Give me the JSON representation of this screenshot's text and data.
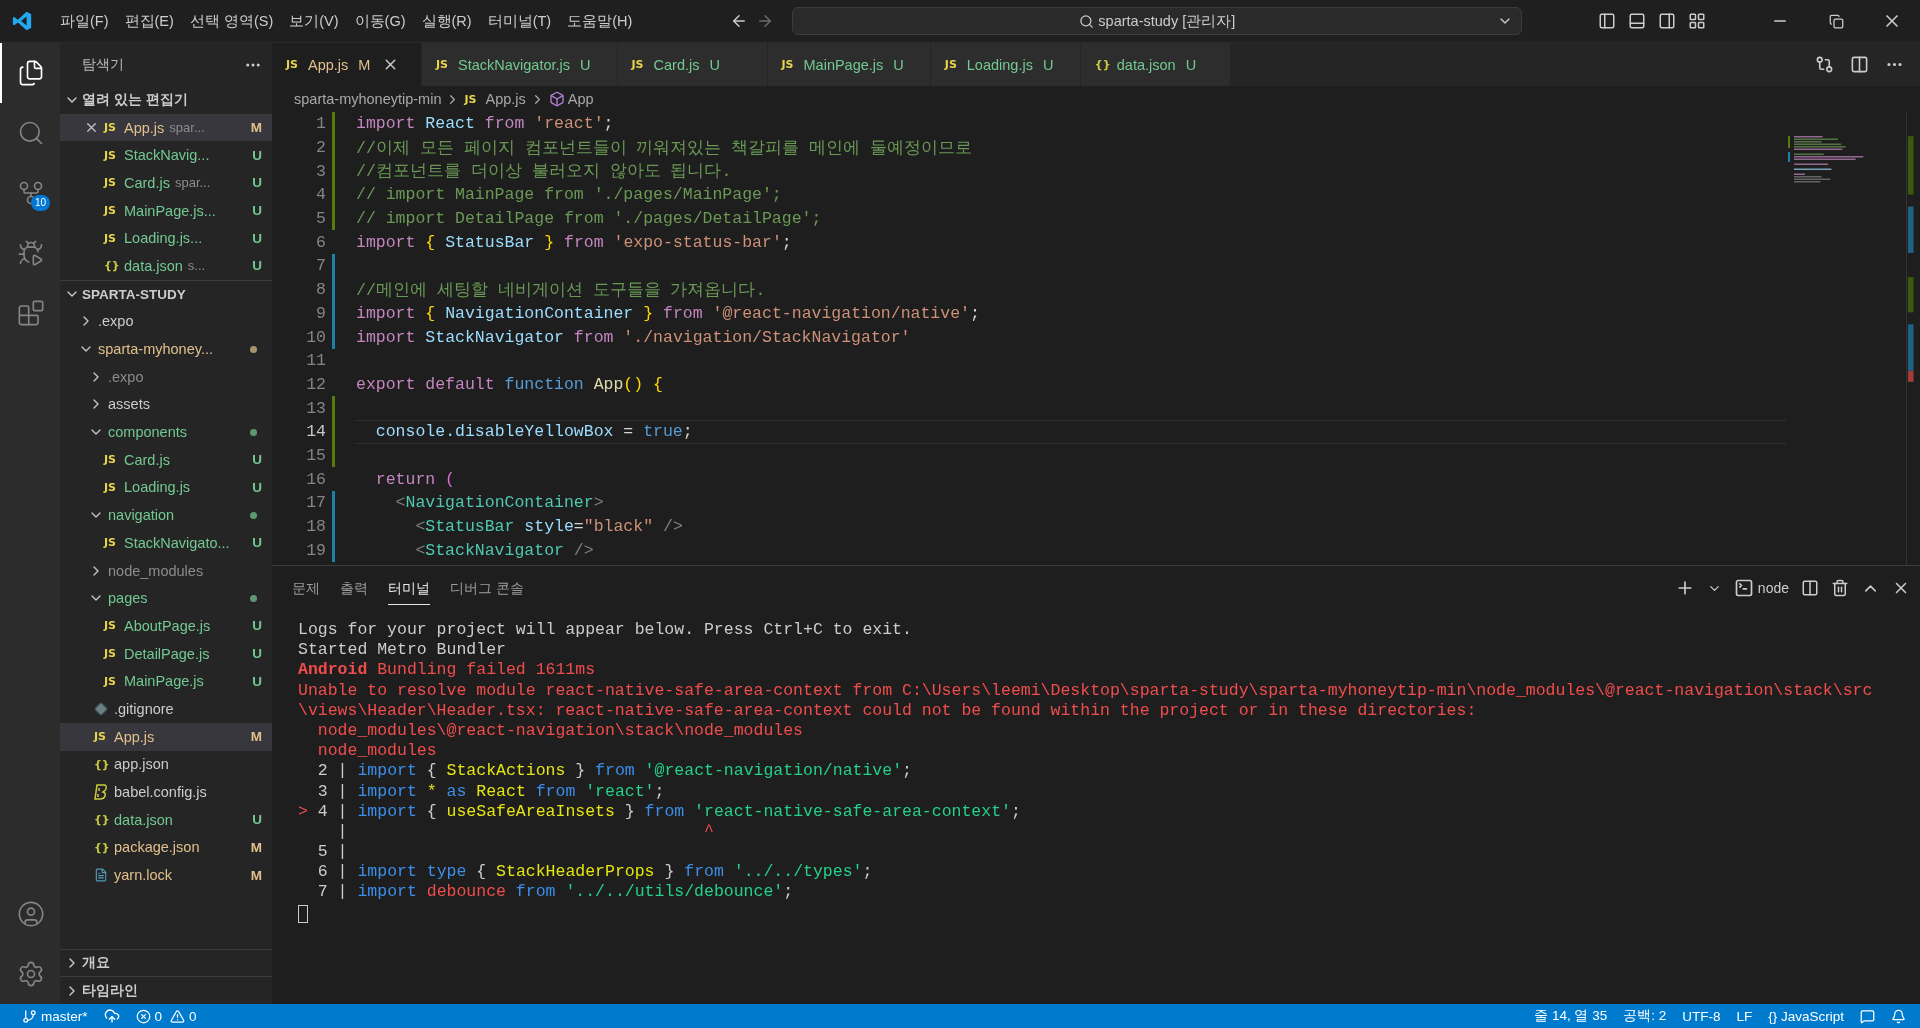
{
  "title_bar": {
    "menu": [
      "파일(F)",
      "편집(E)",
      "선택 영역(S)",
      "보기(V)",
      "이동(G)",
      "실행(R)",
      "터미널(T)",
      "도움말(H)"
    ],
    "search": "sparta-study [관리자]"
  },
  "activity_bar": {
    "items": [
      {
        "kind": "explorer",
        "selected": true
      },
      {
        "kind": "search",
        "selected": false
      },
      {
        "kind": "scm",
        "selected": false,
        "badge": "10"
      },
      {
        "kind": "debug",
        "selected": false
      },
      {
        "kind": "extensions",
        "selected": false
      }
    ],
    "bottom": [
      {
        "kind": "account"
      },
      {
        "kind": "settings"
      }
    ]
  },
  "sidebar": {
    "title": "탐색기",
    "open_editors": {
      "label": "열려 있는 편집기",
      "expanded": true,
      "items": [
        {
          "name": "App.js",
          "description": "spar...",
          "kind": "js",
          "glyph": "JS",
          "status": "M",
          "color": "#e2c08d",
          "selected": true
        },
        {
          "name": "StackNavig...",
          "kind": "js",
          "glyph": "JS",
          "status": "U",
          "color": "#73c991",
          "selected": false
        },
        {
          "name": "Card.js",
          "description": "spar...",
          "kind": "js",
          "glyph": "JS",
          "status": "U",
          "color": "#73c991",
          "selected": false
        },
        {
          "name": "MainPage.js...",
          "kind": "js",
          "glyph": "JS",
          "status": "U",
          "color": "#73c991",
          "selected": false
        },
        {
          "name": "Loading.js...",
          "kind": "js",
          "glyph": "JS",
          "status": "U",
          "color": "#73c991",
          "selected": false
        },
        {
          "name": "data.json",
          "description": "s...",
          "kind": "json",
          "glyph": "{}",
          "status": "U",
          "color": "#73c991",
          "selected": false
        }
      ]
    },
    "workspace": {
      "label": "SPARTA-STUDY",
      "expanded": true,
      "children": [
        {
          "kind": "folder",
          "name": ".expo",
          "expanded": false,
          "color": "#cccccc",
          "dot": false,
          "selected": false
        },
        {
          "kind": "folder",
          "name": "sparta-myhoney...",
          "expanded": true,
          "color": "#e2c08d",
          "dot": true,
          "selected": false,
          "children": [
            {
              "kind": "folder",
              "name": ".expo",
              "expanded": false,
              "color": "#8c8c8c",
              "dot": false,
              "selected": false
            },
            {
              "kind": "folder",
              "name": "assets",
              "expanded": false,
              "color": "#cccccc",
              "dot": false,
              "selected": false
            },
            {
              "kind": "folder",
              "name": "components",
              "expanded": true,
              "color": "#73c991",
              "dot": true,
              "selected": false,
              "children": [
                {
                  "kind": "js",
                  "name": "Card.js",
                  "glyph": "JS",
                  "status": "U",
                  "color": "#73c991",
                  "selected": false
                },
                {
                  "kind": "js",
                  "name": "Loading.js",
                  "glyph": "JS",
                  "status": "U",
                  "color": "#73c991",
                  "selected": false
                }
              ]
            },
            {
              "kind": "folder",
              "name": "navigation",
              "expanded": true,
              "color": "#73c991",
              "dot": true,
              "selected": false,
              "children": [
                {
                  "kind": "js",
                  "name": "StackNavigato...",
                  "glyph": "JS",
                  "status": "U",
                  "color": "#73c991",
                  "selected": false
                }
              ]
            },
            {
              "kind": "folder",
              "name": "node_modules",
              "expanded": false,
              "color": "#8c8c8c",
              "dot": false,
              "selected": false
            },
            {
              "kind": "folder",
              "name": "pages",
              "expanded": true,
              "color": "#73c991",
              "dot": true,
              "selected": false,
              "children": [
                {
                  "kind": "js",
                  "name": "AboutPage.js",
                  "glyph": "JS",
                  "status": "U",
                  "color": "#73c991",
                  "selected": false
                },
                {
                  "kind": "js",
                  "name": "DetailPage.js",
                  "glyph": "JS",
                  "status": "U",
                  "color": "#73c991",
                  "selected": false
                },
                {
                  "kind": "js",
                  "name": "MainPage.js",
                  "glyph": "JS",
                  "status": "U",
                  "color": "#73c991",
                  "selected": false
                }
              ]
            },
            {
              "kind": "git",
              "name": ".gitignore",
              "color": "#cccccc",
              "selected": false
            },
            {
              "kind": "js",
              "name": "App.js",
              "glyph": "JS",
              "status": "M",
              "color": "#e2c08d",
              "selected": true
            },
            {
              "kind": "json",
              "name": "app.json",
              "glyph": "{}",
              "color": "#cccccc",
              "selected": false
            },
            {
              "kind": "babel",
              "name": "babel.config.js",
              "color": "#cccccc",
              "selected": false
            },
            {
              "kind": "json",
              "name": "data.json",
              "glyph": "{}",
              "status": "U",
              "color": "#73c991",
              "selected": false
            },
            {
              "kind": "json",
              "name": "package.json",
              "glyph": "{}",
              "status": "M",
              "color": "#e2c08d",
              "selected": false
            },
            {
              "kind": "yarn",
              "name": "yarn.lock",
              "status": "M",
              "color": "#e2c08d",
              "selected": false
            }
          ]
        }
      ]
    },
    "sections": [
      {
        "label": "개요",
        "expanded": false
      },
      {
        "label": "타임라인",
        "expanded": false
      }
    ]
  },
  "tabs": [
    {
      "label": "App.js",
      "kind": "js",
      "glyph": "JS",
      "status": "M",
      "color": "#e2c08d",
      "selected": true
    },
    {
      "label": "StackNavigator.js",
      "kind": "js",
      "glyph": "JS",
      "status": "U",
      "color": "#73c991",
      "selected": false
    },
    {
      "label": "Card.js",
      "kind": "js",
      "glyph": "JS",
      "status": "U",
      "color": "#73c991",
      "selected": false
    },
    {
      "label": "MainPage.js",
      "kind": "js",
      "glyph": "JS",
      "status": "U",
      "color": "#73c991",
      "selected": false
    },
    {
      "label": "Loading.js",
      "kind": "js",
      "glyph": "JS",
      "status": "U",
      "color": "#73c991",
      "selected": false
    },
    {
      "label": "data.json",
      "kind": "json",
      "glyph": "{}",
      "status": "U",
      "color": "#73c991",
      "selected": false
    }
  ],
  "breadcrumb": [
    {
      "kind": "folder",
      "label": "sparta-myhoneytip-min"
    },
    {
      "kind": "file",
      "glyph": "JS",
      "label": "App.js"
    },
    {
      "kind": "symbol",
      "label": "App"
    }
  ],
  "editor": {
    "lines": [
      {
        "number": "1",
        "kind": "modified",
        "current": false,
        "tokens": [
          {
            "text": "import",
            "kind": "kw"
          },
          {
            "text": " React",
            "kind": "var"
          },
          {
            "text": " from",
            "kind": "kw"
          },
          {
            "text": " 'react'",
            "kind": "str"
          },
          {
            "text": ";",
            "kind": "p"
          }
        ]
      },
      {
        "number": "2",
        "kind": "modified",
        "current": false,
        "tokens": [
          {
            "text": "//이제 모든 페이지 컴포넌트들이 끼워져있는 책갈피를 메인에 둘예정이므로",
            "kind": "com"
          }
        ]
      },
      {
        "number": "3",
        "kind": "modified",
        "current": false,
        "tokens": [
          {
            "text": "//컴포넌트를 더이상 불러오지 않아도 됩니다.",
            "kind": "com"
          }
        ]
      },
      {
        "number": "4",
        "kind": "modified",
        "current": false,
        "tokens": [
          {
            "text": "// import MainPage from './pages/MainPage';",
            "kind": "com"
          }
        ]
      },
      {
        "number": "5",
        "kind": "modified",
        "current": false,
        "tokens": [
          {
            "text": "// import DetailPage from './pages/DetailPage';",
            "kind": "com"
          }
        ]
      },
      {
        "number": "6",
        "kind": "none",
        "current": false,
        "tokens": [
          {
            "text": "import",
            "kind": "kw"
          },
          {
            "text": " {",
            "kind": "brace"
          },
          {
            "text": " StatusBar",
            "kind": "var"
          },
          {
            "text": " }",
            "kind": "brace"
          },
          {
            "text": " from",
            "kind": "kw"
          },
          {
            "text": " 'expo-status-bar'",
            "kind": "str"
          },
          {
            "text": ";",
            "kind": "p"
          }
        ]
      },
      {
        "number": "7",
        "kind": "added",
        "current": false
      },
      {
        "number": "8",
        "kind": "added",
        "current": false,
        "tokens": [
          {
            "text": "//메인에 세팅할 네비게이션 도구들을 가져옵니다.",
            "kind": "com"
          }
        ]
      },
      {
        "number": "9",
        "kind": "added",
        "current": false,
        "tokens": [
          {
            "text": "import",
            "kind": "kw"
          },
          {
            "text": " {",
            "kind": "brace"
          },
          {
            "text": " NavigationContainer",
            "kind": "var"
          },
          {
            "text": " }",
            "kind": "brace"
          },
          {
            "text": " from",
            "kind": "kw"
          },
          {
            "text": " '@react-navigation/native'",
            "kind": "str"
          },
          {
            "text": ";",
            "kind": "p"
          }
        ]
      },
      {
        "number": "10",
        "kind": "added",
        "current": false,
        "tokens": [
          {
            "text": "import",
            "kind": "kw"
          },
          {
            "text": " StackNavigator",
            "kind": "var"
          },
          {
            "text": " from",
            "kind": "kw"
          },
          {
            "text": " './navigation/StackNavigator'",
            "kind": "str"
          }
        ]
      },
      {
        "number": "11",
        "kind": "none",
        "current": false
      },
      {
        "number": "12",
        "kind": "none",
        "current": false,
        "tokens": [
          {
            "text": "export default",
            "kind": "kw"
          },
          {
            "text": " function",
            "kind": "kw2"
          },
          {
            "text": " App",
            "kind": "fn"
          },
          {
            "text": "()",
            "kind": "brace"
          },
          {
            "text": " {",
            "kind": "brace"
          }
        ]
      },
      {
        "number": "13",
        "kind": "modified",
        "current": false
      },
      {
        "number": "14",
        "kind": "modified",
        "current": true,
        "tokens": [
          {
            "text": "  console",
            "kind": "var"
          },
          {
            "text": ".disableYellowBox",
            "kind": "var"
          },
          {
            "text": " =",
            "kind": "p"
          },
          {
            "text": " true",
            "kind": "kw2"
          },
          {
            "text": ";",
            "kind": "p"
          }
        ]
      },
      {
        "number": "15",
        "kind": "modified",
        "current": false
      },
      {
        "number": "16",
        "kind": "none",
        "current": false,
        "tokens": [
          {
            "text": "  return",
            "kind": "kw"
          },
          {
            "text": " (",
            "kind": "brace2"
          }
        ]
      },
      {
        "number": "17",
        "kind": "added",
        "current": false,
        "tokens": [
          {
            "text": "    <",
            "kind": "punct"
          },
          {
            "text": "NavigationContainer",
            "kind": "tag"
          },
          {
            "text": ">",
            "kind": "punct"
          }
        ]
      },
      {
        "number": "18",
        "kind": "added",
        "current": false,
        "tokens": [
          {
            "text": "      <",
            "kind": "punct"
          },
          {
            "text": "StatusBar",
            "kind": "tag"
          },
          {
            "text": " style",
            "kind": "var"
          },
          {
            "text": "=",
            "kind": "p"
          },
          {
            "text": "\"black\"",
            "kind": "str"
          },
          {
            "text": " />",
            "kind": "punct"
          }
        ]
      },
      {
        "number": "19",
        "kind": "added",
        "current": false,
        "tokens": [
          {
            "text": "      <",
            "kind": "punct"
          },
          {
            "text": "StackNavigator",
            "kind": "tag"
          },
          {
            "text": " />",
            "kind": "punct"
          }
        ]
      }
    ]
  },
  "panel": {
    "tabs": [
      {
        "label": "문제",
        "selected": false
      },
      {
        "label": "출력",
        "selected": false
      },
      {
        "label": "터미널",
        "selected": true
      },
      {
        "label": "디버그 콘솔",
        "selected": false
      }
    ],
    "terminal_name": "node",
    "lines": [
      {
        "tokens": [
          {
            "text": "Logs for your project will appear below. Press Ctrl+C to exit.",
            "kind": "t"
          }
        ]
      },
      {
        "tokens": [
          {
            "text": "Started Metro Bundler",
            "kind": "t"
          }
        ]
      },
      {
        "tokens": [
          {
            "text": "Android",
            "kind": "rb"
          },
          {
            "text": " Bundling failed 1611ms",
            "kind": "r"
          }
        ]
      },
      {
        "tokens": [
          {
            "text": "Unable to resolve module react-native-safe-area-context from C:\\Users\\leemi\\Desktop\\sparta-study\\sparta-myhoneytip-min\\node_modules\\@react-navigation\\stack\\src",
            "kind": "r"
          }
        ]
      },
      {
        "tokens": [
          {
            "text": "\\views\\Header\\Header.tsx: react-native-safe-area-context could not be found within the project or in these directories:",
            "kind": "r"
          }
        ]
      },
      {
        "tokens": [
          {
            "text": "  node_modules\\@react-navigation\\stack\\node_modules",
            "kind": "r"
          }
        ]
      },
      {
        "tokens": [
          {
            "text": "  node_modules",
            "kind": "r"
          }
        ]
      },
      {
        "tokens": [
          {
            "text": "  2 | ",
            "kind": "t"
          },
          {
            "text": "import",
            "kind": "b"
          },
          {
            "text": " { ",
            "kind": "t"
          },
          {
            "text": "StackActions",
            "kind": "y"
          },
          {
            "text": " } ",
            "kind": "t"
          },
          {
            "text": "from",
            "kind": "b"
          },
          {
            "text": " '@react-navigation/native'",
            "kind": "g"
          },
          {
            "text": ";",
            "kind": "t"
          }
        ]
      },
      {
        "tokens": [
          {
            "text": "  3 | ",
            "kind": "t"
          },
          {
            "text": "import",
            "kind": "b"
          },
          {
            "text": " *",
            "kind": "y"
          },
          {
            "text": " as",
            "kind": "b"
          },
          {
            "text": " React",
            "kind": "y"
          },
          {
            "text": " from",
            "kind": "b"
          },
          {
            "text": " 'react'",
            "kind": "g"
          },
          {
            "text": ";",
            "kind": "t"
          }
        ]
      },
      {
        "tokens": [
          {
            "text": "> ",
            "kind": "r"
          },
          {
            "text": "4 | ",
            "kind": "t"
          },
          {
            "text": "import",
            "kind": "b"
          },
          {
            "text": " { ",
            "kind": "t"
          },
          {
            "text": "useSafeAreaInsets",
            "kind": "y"
          },
          {
            "text": " } ",
            "kind": "t"
          },
          {
            "text": "from",
            "kind": "b"
          },
          {
            "text": " 'react-native-safe-area-context'",
            "kind": "g"
          },
          {
            "text": ";",
            "kind": "t"
          }
        ]
      },
      {
        "tokens": [
          {
            "text": "    | ",
            "kind": "t"
          },
          {
            "text": "                                   ^",
            "kind": "r"
          }
        ]
      },
      {
        "tokens": [
          {
            "text": "  5 |",
            "kind": "t"
          }
        ]
      },
      {
        "tokens": [
          {
            "text": "  6 | ",
            "kind": "t"
          },
          {
            "text": "import",
            "kind": "b"
          },
          {
            "text": " type",
            "kind": "b"
          },
          {
            "text": " { ",
            "kind": "t"
          },
          {
            "text": "StackHeaderProps",
            "kind": "y"
          },
          {
            "text": " } ",
            "kind": "t"
          },
          {
            "text": "from",
            "kind": "b"
          },
          {
            "text": " '../../types'",
            "kind": "g"
          },
          {
            "text": ";",
            "kind": "t"
          }
        ]
      },
      {
        "tokens": [
          {
            "text": "  7 | ",
            "kind": "t"
          },
          {
            "text": "import",
            "kind": "b"
          },
          {
            "text": " debounce",
            "kind": "r"
          },
          {
            "text": " from",
            "kind": "b"
          },
          {
            "text": " '../../utils/debounce'",
            "kind": "g"
          },
          {
            "text": ";",
            "kind": "t"
          }
        ]
      }
    ]
  },
  "status_bar": {
    "branch": "master*",
    "problems": [
      {
        "kind": "error",
        "count": "0"
      },
      {
        "kind": "warning",
        "count": "0"
      }
    ],
    "items": [
      "줄 14, 열 35",
      "공백: 2",
      "UTF-8",
      "LF",
      "{} JavaScript"
    ]
  }
}
